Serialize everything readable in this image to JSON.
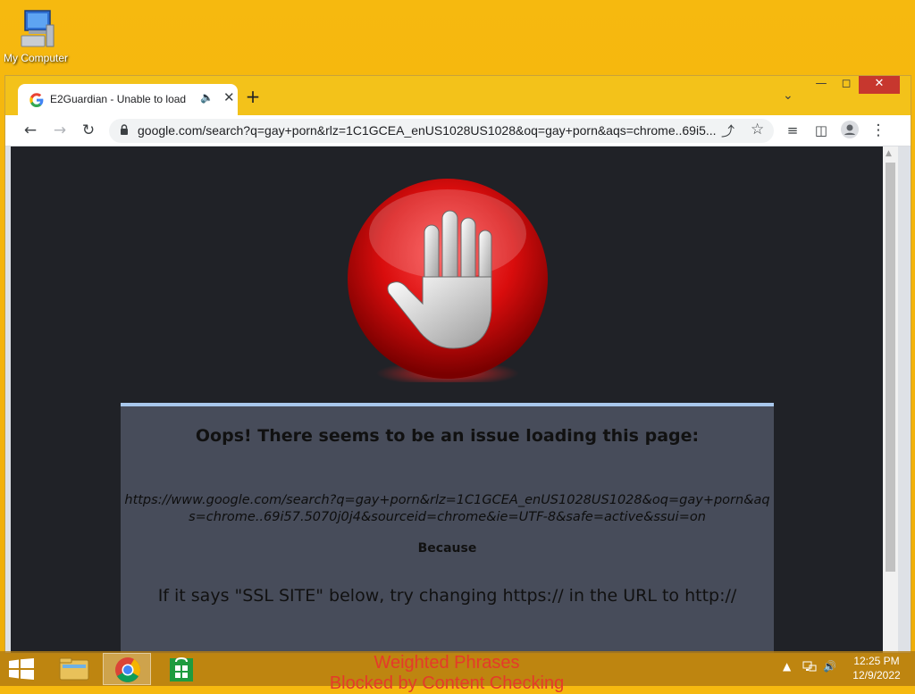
{
  "desktop": {
    "icon_label": "My Computer"
  },
  "browser": {
    "tab_title": "E2Guardian - Unable to load",
    "url": "google.com/search?q=gay+porn&rlz=1C1GCEA_enUS1028US1028&oq=gay+porn&aqs=chrome..69i5..."
  },
  "page": {
    "heading": "Oops! There seems to be an issue loading this page:",
    "blocked_url": "https://www.google.com/search?q=gay+porn&rlz=1C1GCEA_enUS1028US1028&oq=gay+porn&aqs=chrome..69i57.5070j0j4&sourceid=chrome&ie=UTF-8&safe=active&ssui=on",
    "because": "Because",
    "ssl_hint": "If it says \"SSL SITE\" below, try changing https:// in the URL to http://",
    "reason_line1": "Weighted Phrases",
    "reason_line2": "Blocked by Content Checking"
  },
  "taskbar": {
    "time": "12:25 PM",
    "date": "12/9/2022"
  },
  "colors": {
    "desktop_bg": "#f6b90f",
    "page_bg": "#202227",
    "panel_bg": "#474c5a",
    "panel_border": "#a9c8ec",
    "reason_text": "#e53a2a",
    "close_button": "#c7372e"
  }
}
